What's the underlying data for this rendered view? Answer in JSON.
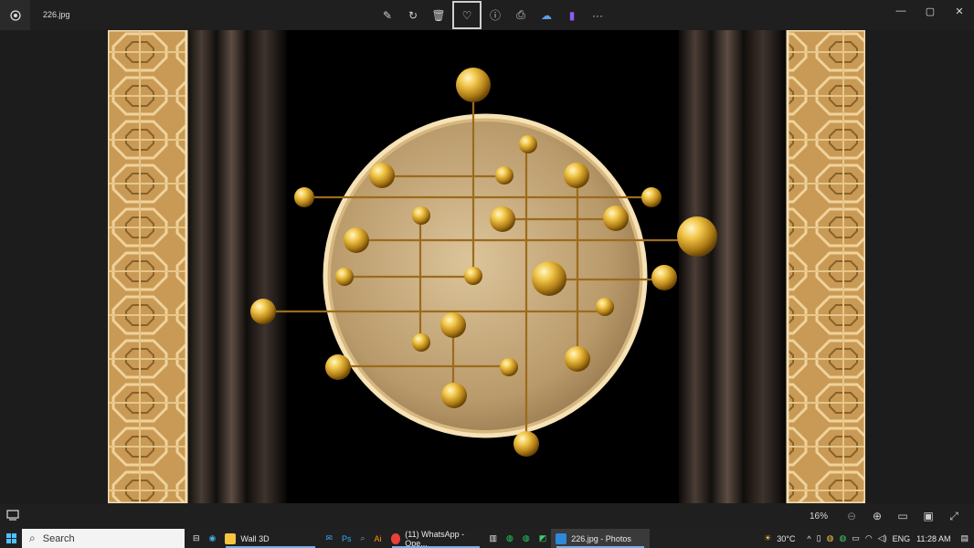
{
  "window": {
    "title": "226.jpg"
  },
  "toolbar": {
    "buttons": [
      {
        "name": "edit-image-icon",
        "glyph": "✎"
      },
      {
        "name": "rotate-icon",
        "glyph": "↻"
      },
      {
        "name": "delete-icon",
        "glyph": "🗑"
      },
      {
        "name": "favorite-heart-icon",
        "glyph": "♡"
      },
      {
        "name": "info-icon",
        "glyph": "ⓘ"
      },
      {
        "name": "print-icon",
        "glyph": "⎙"
      },
      {
        "name": "onedrive-icon",
        "glyph": "☁"
      },
      {
        "name": "clipchamp-icon",
        "glyph": "▮"
      },
      {
        "name": "more-options-icon",
        "glyph": "···"
      }
    ]
  },
  "window_controls": {
    "minimize": "—",
    "maximize": "▢",
    "close": "✕"
  },
  "status": {
    "zoom": "16%"
  },
  "taskbar": {
    "search_label": "Search",
    "items": [
      {
        "label": "Wall 3D",
        "color": "#f5c542"
      },
      {
        "label": "(11) WhatsApp - Ope...",
        "color": "#e8403a"
      },
      {
        "label": "226.jpg - Photos",
        "color": "#2e89d8"
      }
    ],
    "weather": "30°C",
    "language": "ENG",
    "time": "11:28 AM"
  },
  "colors": {
    "accent": "#7aaee8",
    "gold": "#d9a93a"
  }
}
